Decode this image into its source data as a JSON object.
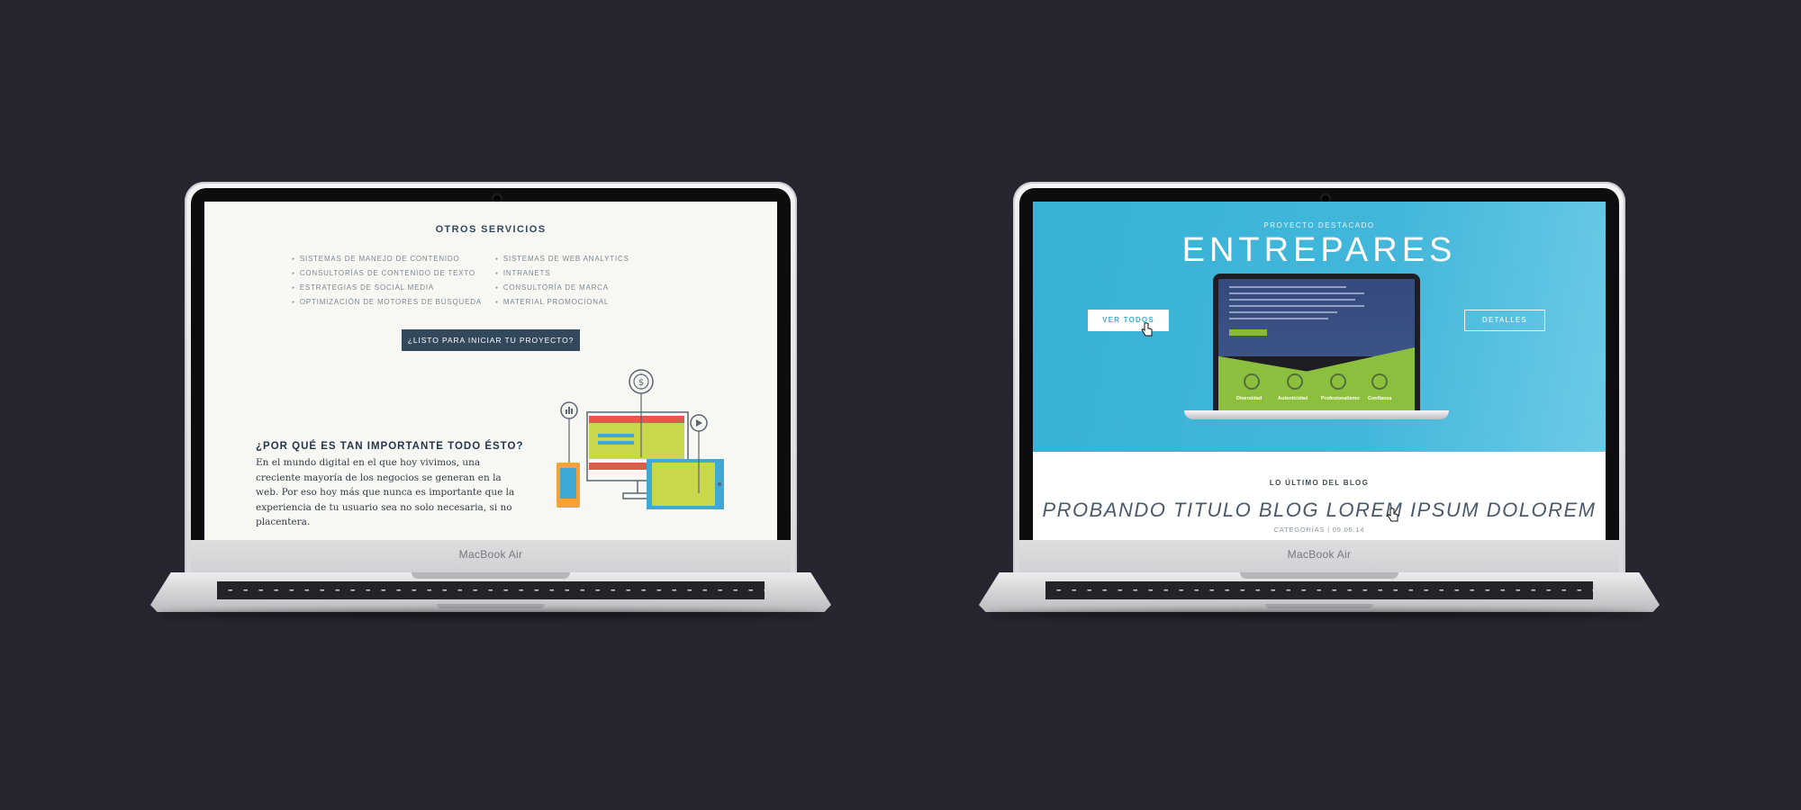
{
  "background_color": "#262631",
  "laptop_brand": "MacBook Air",
  "left_screen": {
    "section_title": "OTROS SERVICIOS",
    "services_col1": [
      "SISTEMAS DE MANEJO DE CONTENIDO",
      "CONSULTORÍAS DE CONTENIDO DE TEXTO",
      "ESTRATEGIAS DE SOCIAL MEDIA",
      "OPTIMIZACIÓN DE MOTORES DE BÚSQUEDA"
    ],
    "services_col2": [
      "SISTEMAS DE WEB ANALYTICS",
      "INTRANETS",
      "CONSULTORÍA DE MARCA",
      "MATERIAL PROMOCIONAL"
    ],
    "cta_label": "¿LISTO PARA INICIAR TU PROYECTO?",
    "why_heading": "¿POR QUÉ ES TAN IMPORTANTE TODO ÉSTO?",
    "why_text": "En el mundo digital en el que hoy vivimos, una creciente mayoría de los negocios se generan en la web. Por eso hoy más que nunca es importante que la experiencia de tu usuario sea no solo necesaria, si no placentera.",
    "colors": {
      "primary": "#34485c",
      "accent_yellow": "#c9d84a",
      "accent_red": "#e05a4a",
      "accent_blue": "#3fa9d6",
      "accent_orange": "#f2a33a"
    },
    "icons": [
      "dollar-icon",
      "chart-icon",
      "play-icon"
    ]
  },
  "right_screen": {
    "eyebrow": "PROYECTO DESTACADO",
    "project_title": "ENTREPARES",
    "view_all_label": "VER TODOS",
    "details_label": "DETALLES",
    "mini_features": [
      "Diversidad",
      "Autenticidad",
      "Profesionalismo",
      "Confianza"
    ],
    "blog_label": "LO ÚLTIMO DEL BLOG",
    "blog_title": "PROBANDO TITULO BLOG LOREM IPSUM DOLOREM",
    "blog_meta": "CATEGORÍAS | 09.06.14",
    "colors": {
      "hero": "#3fb3d8",
      "mini_green": "#8dbf3f",
      "mini_navy": "#354a7d"
    }
  }
}
